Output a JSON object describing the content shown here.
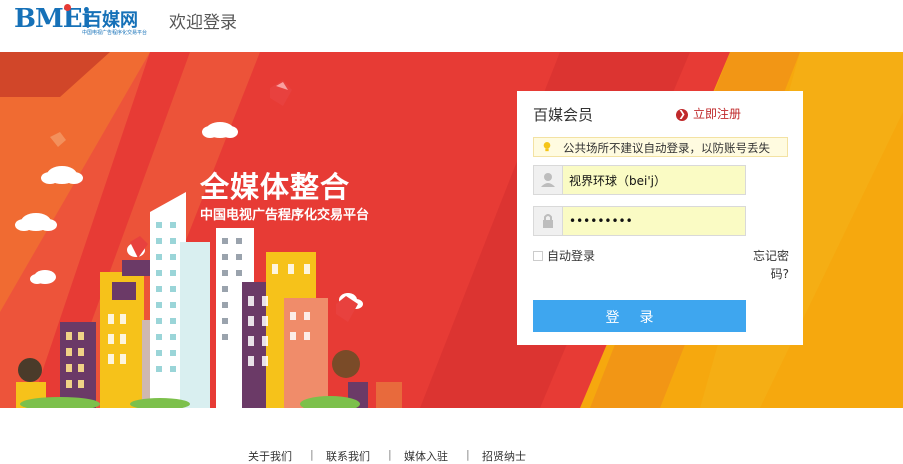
{
  "header": {
    "logo_mark": "BMEi",
    "logo_name": "百媒网",
    "logo_tagline": "中国电视广告程序化交易平台",
    "page_title": "欢迎登录"
  },
  "banner": {
    "slogan_main": "全媒体整合",
    "slogan_sub": "中国电视广告程序化交易平台",
    "colors": {
      "red": "#e73b35",
      "orange": "#f6a80e"
    }
  },
  "login": {
    "title": "百媒会员",
    "register_icon": "arrow-circle-icon",
    "register_label": "立即注册",
    "notice_icon": "lightbulb-icon",
    "notice_text": "公共场所不建议自动登录，以防账号丢失",
    "username_icon": "user-icon",
    "username_value": "视界环球（bei'j）",
    "password_icon": "lock-icon",
    "password_value": "abcdefghi",
    "remember_label": "自动登录",
    "forgot_label": "忘记密码?",
    "submit_label": "登录",
    "accent": "#3ea6ef"
  },
  "footer": {
    "links": [
      "关于我们",
      "联系我们",
      "媒体入驻",
      "招贤纳士"
    ]
  }
}
